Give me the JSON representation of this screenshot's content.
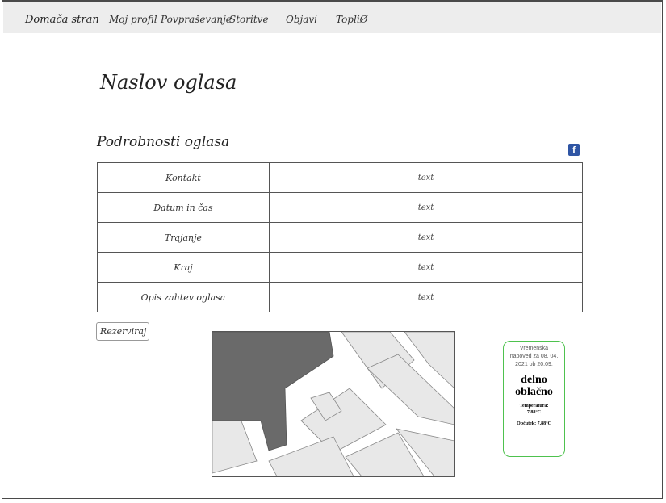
{
  "nav": {
    "items": [
      "Domača stran",
      "Moj profil",
      "Povpraševanje",
      "Storitve",
      "Objavi",
      "TopliØ"
    ]
  },
  "ad": {
    "title": "Naslov oglasa",
    "details_heading": "Podrobnosti oglasa",
    "share_icon": "facebook-icon",
    "rows": [
      {
        "label": "Kontakt",
        "value": "text"
      },
      {
        "label": "Datum in čas",
        "value": "text"
      },
      {
        "label": "Trajanje",
        "value": "text"
      },
      {
        "label": "Kraj",
        "value": "text"
      },
      {
        "label": "Opis zahtev oglasa",
        "value": "text"
      }
    ],
    "reserve_label": "Rezerviraj"
  },
  "weather": {
    "line1": "Vremenska",
    "line2": "napoved za 08. 04.",
    "line3": "2021 ob 20:09:",
    "condition_line1": "delno",
    "condition_line2": "oblačno",
    "temp_label": "Temperatura:",
    "temp_value": "7.88°C",
    "feels_label": "Občutek: ",
    "feels_value": "7.88°C"
  },
  "colors": {
    "navbar_bg": "#ededed",
    "map_block": "#6a6a6a",
    "map_area": "#e8e8e8",
    "weather_border": "#4ec24e",
    "facebook": "#2f55a4"
  }
}
